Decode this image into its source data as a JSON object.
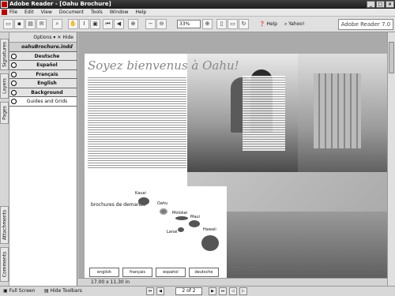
{
  "window": {
    "title": "Adobe Reader - [Oahu Brochure]"
  },
  "menu": [
    "File",
    "Edit",
    "View",
    "Document",
    "Tools",
    "Window",
    "Help"
  ],
  "toolbar": {
    "zoom": "33%",
    "help_label": "Help",
    "yahoo_label": "Yahoo!",
    "brand": "Adobe Reader 7.0"
  },
  "side_tabs": [
    "Signatures",
    "Layers",
    "Pages",
    "Attachments",
    "Comments"
  ],
  "layers_panel": {
    "options_label": "Options",
    "hide_label": "Hide",
    "root": "oahuBrochure.indd",
    "layers": [
      "Deutsche",
      "Español",
      "Français",
      "English",
      "Background",
      "Guides and Grids"
    ]
  },
  "document": {
    "title": "Soyez bienvenus à Oahu!",
    "brochure_label": "brochures de demande",
    "islands": [
      "Kauai",
      "Oahu",
      "Molokai",
      "Maui",
      "Lanai",
      "Hawaii"
    ],
    "languages": [
      "english",
      "français",
      "español",
      "deutsche"
    ]
  },
  "status": {
    "page_size": "17.00 x 11.30 in",
    "full_screen": "Full Screen",
    "hide_toolbars": "Hide Toolbars",
    "page_indicator": "2 of 2"
  }
}
